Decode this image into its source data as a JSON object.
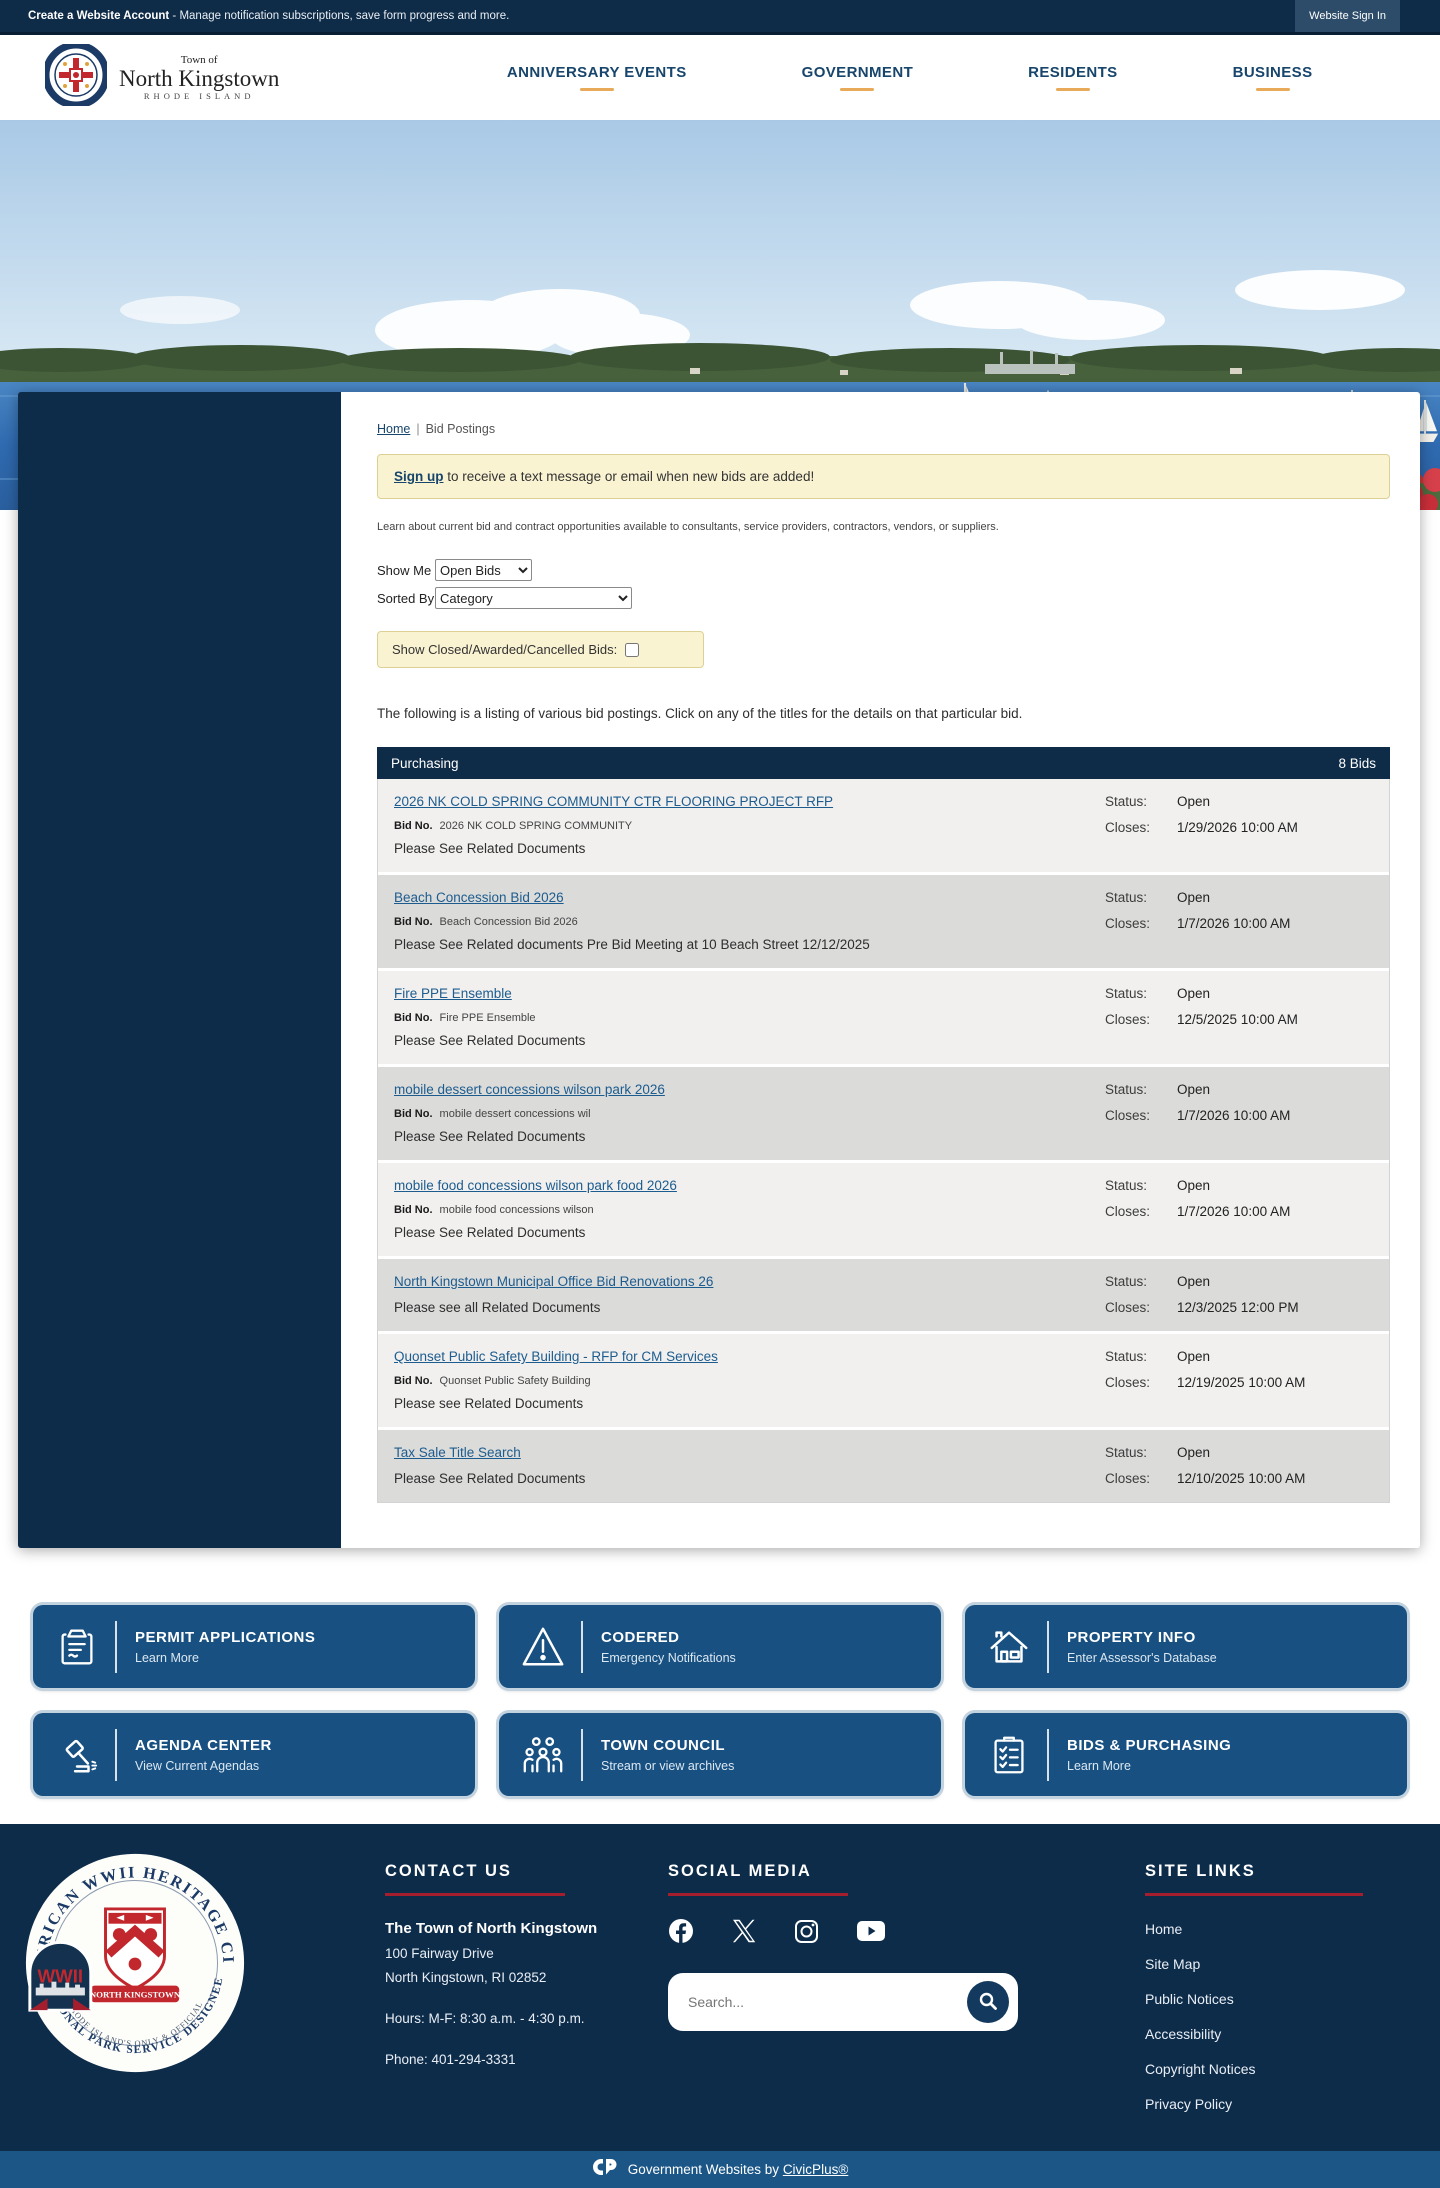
{
  "topbar": {
    "message_bold": "Create a Website Account",
    "message_rest": " - Manage notification subscriptions, save form progress and more.",
    "signin": "Website Sign In"
  },
  "header": {
    "logo_line1": "Town of",
    "logo_line2": "North Kingstown",
    "logo_line3": "RHODE ISLAND",
    "nav": [
      "ANNIVERSARY EVENTS",
      "GOVERNMENT",
      "RESIDENTS",
      "BUSINESS"
    ]
  },
  "breadcrumb": {
    "home": "Home",
    "sep": "|",
    "current": "Bid Postings"
  },
  "notice": {
    "link_text": "Sign up",
    "rest": " to receive a text message or email when new bids are added!"
  },
  "intro": "Learn about current bid and contract opportunities available to consultants, service providers, contractors, vendors, or suppliers.",
  "filters": {
    "show_me_label": "Show Me",
    "show_me_value": "Open Bids",
    "sorted_by_label": "Sorted By",
    "sorted_by_value": "Category",
    "closed_label": "Show Closed/Awarded/Cancelled Bids:"
  },
  "listing_intro": "The following is a listing of various bid postings. Click on any of the titles for the details on that particular bid.",
  "table": {
    "category": "Purchasing",
    "count": "8 Bids",
    "bid_no_label": "Bid No.",
    "status_label": "Status:",
    "closes_label": "Closes:",
    "rows": [
      {
        "title": "2026 NK COLD SPRING COMMUNITY CTR FLOORING PROJECT RFP",
        "bid_no": "2026 NK COLD SPRING COMMUNITY",
        "note": "Please See Related Documents",
        "status": "Open",
        "closes": "1/29/2026 10:00 AM"
      },
      {
        "title": "Beach Concession Bid 2026",
        "bid_no": "Beach Concession Bid 2026",
        "note": "Please See Related documents Pre Bid Meeting at 10 Beach Street 12/12/2025",
        "status": "Open",
        "closes": "1/7/2026 10:00 AM"
      },
      {
        "title": "Fire PPE Ensemble",
        "bid_no": "Fire PPE Ensemble",
        "note": "Please See Related Documents",
        "status": "Open",
        "closes": "12/5/2025 10:00 AM"
      },
      {
        "title": "mobile dessert concessions wilson park 2026",
        "bid_no": "mobile dessert concessions wil",
        "note": "Please See Related Documents",
        "status": "Open",
        "closes": "1/7/2026 10:00 AM"
      },
      {
        "title": "mobile food concessions wilson park food 2026",
        "bid_no": "mobile food concessions wilson",
        "note": "Please See Related Documents",
        "status": "Open",
        "closes": "1/7/2026 10:00 AM"
      },
      {
        "title": "North Kingstown Municipal Office Bid Renovations 26",
        "bid_no": "",
        "note": "Please see all Related Documents",
        "status": "Open",
        "closes": "12/3/2025 12:00 PM"
      },
      {
        "title": "Quonset Public Safety Building - RFP for CM Services",
        "bid_no": "Quonset Public Safety Building",
        "note": "Please see Related Documents",
        "status": "Open",
        "closes": "12/19/2025 10:00 AM"
      },
      {
        "title": "Tax Sale Title Search",
        "bid_no": "",
        "note": "Please See Related Documents",
        "status": "Open",
        "closes": "12/10/2025 10:00 AM"
      }
    ]
  },
  "quicklinks": [
    {
      "icon": "permit-icon",
      "title": "PERMIT APPLICATIONS",
      "subtitle": "Learn More"
    },
    {
      "icon": "alert-icon",
      "title": "CODERED",
      "subtitle": "Emergency Notifications"
    },
    {
      "icon": "house-icon",
      "title": "PROPERTY INFO",
      "subtitle": "Enter Assessor's Database"
    },
    {
      "icon": "gavel-icon",
      "title": "AGENDA CENTER",
      "subtitle": "View Current Agendas"
    },
    {
      "icon": "people-icon",
      "title": "TOWN COUNCIL",
      "subtitle": "Stream or view archives"
    },
    {
      "icon": "checklist-icon",
      "title": "BIDS & PURCHASING",
      "subtitle": "Learn More"
    }
  ],
  "footer": {
    "contact": {
      "heading": "CONTACT US",
      "name": "The Town of North Kingstown",
      "addr1": "100 Fairway Drive",
      "addr2": "North Kingstown, RI 02852",
      "hours": "Hours: M-F: 8:30 a.m. - 4:30 p.m.",
      "phone": "Phone: 401-294-3331"
    },
    "social": {
      "heading": "SOCIAL MEDIA",
      "icons": [
        "facebook-icon",
        "x-icon",
        "instagram-icon",
        "youtube-icon"
      ],
      "search_placeholder": "Search..."
    },
    "sitelinks": {
      "heading": "SITE LINKS",
      "links": [
        "Home",
        "Site Map",
        "Public Notices",
        "Accessibility",
        "Copyright Notices",
        "Privacy Policy"
      ]
    },
    "seal": {
      "arc_top": "AMERICAN WWII HERITAGE CITY",
      "arc_bottom_small": "RHODE ISLAND'S ONLY & OFFICIAL",
      "arc_bottom": "NATIONAL PARK SERVICE DESIGNEE",
      "banner": "NORTH KINGSTOWN",
      "badge": "WWII"
    }
  },
  "civic": {
    "prefix": "Government Websites by",
    "link": "CivicPlus®"
  },
  "colors": {
    "navy": "#0d2c4a",
    "accent_red": "#a51e2d",
    "button_blue": "#175081",
    "link_blue": "#1d5c8e",
    "notice_yellow": "#faf3d2"
  }
}
